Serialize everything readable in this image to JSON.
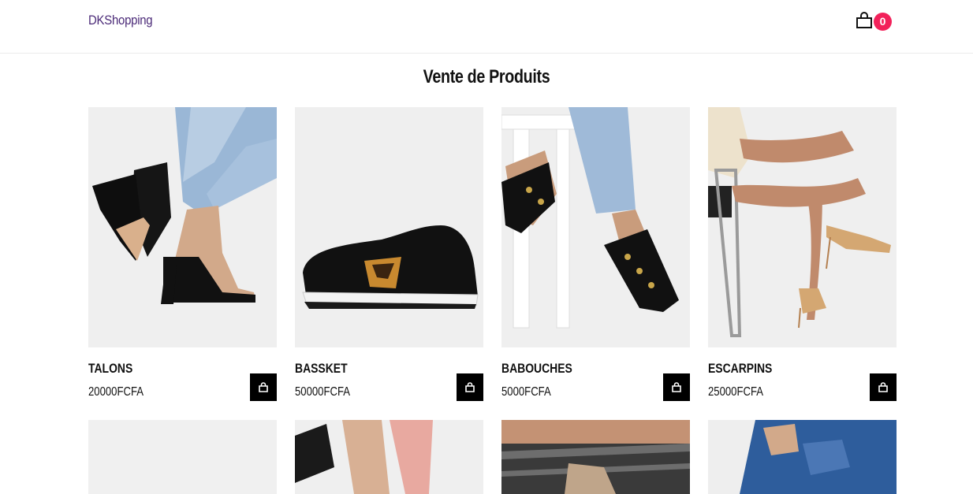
{
  "header": {
    "brand": "DKShopping",
    "cart_count": "0",
    "cart_icon": "shopping-bag-icon"
  },
  "main": {
    "title": "Vente de Produits"
  },
  "products": [
    {
      "name": "TALONS",
      "price": "20000FCFA",
      "image": "black block-heel mules"
    },
    {
      "name": "BASSKET",
      "price": "50000FCFA",
      "image": "black sneaker with leopard N logo"
    },
    {
      "name": "BABOUCHES",
      "price": "5000FCFA",
      "image": "black studded slide sandals"
    },
    {
      "name": "ESCARPINS",
      "price": "25000FCFA",
      "image": "beige pointed stiletto heels"
    }
  ],
  "add_to_cart_icon": "shopping-bag-icon",
  "colors": {
    "brand": "#4b2a78",
    "badge": "#f2215a",
    "button": "#000000"
  }
}
